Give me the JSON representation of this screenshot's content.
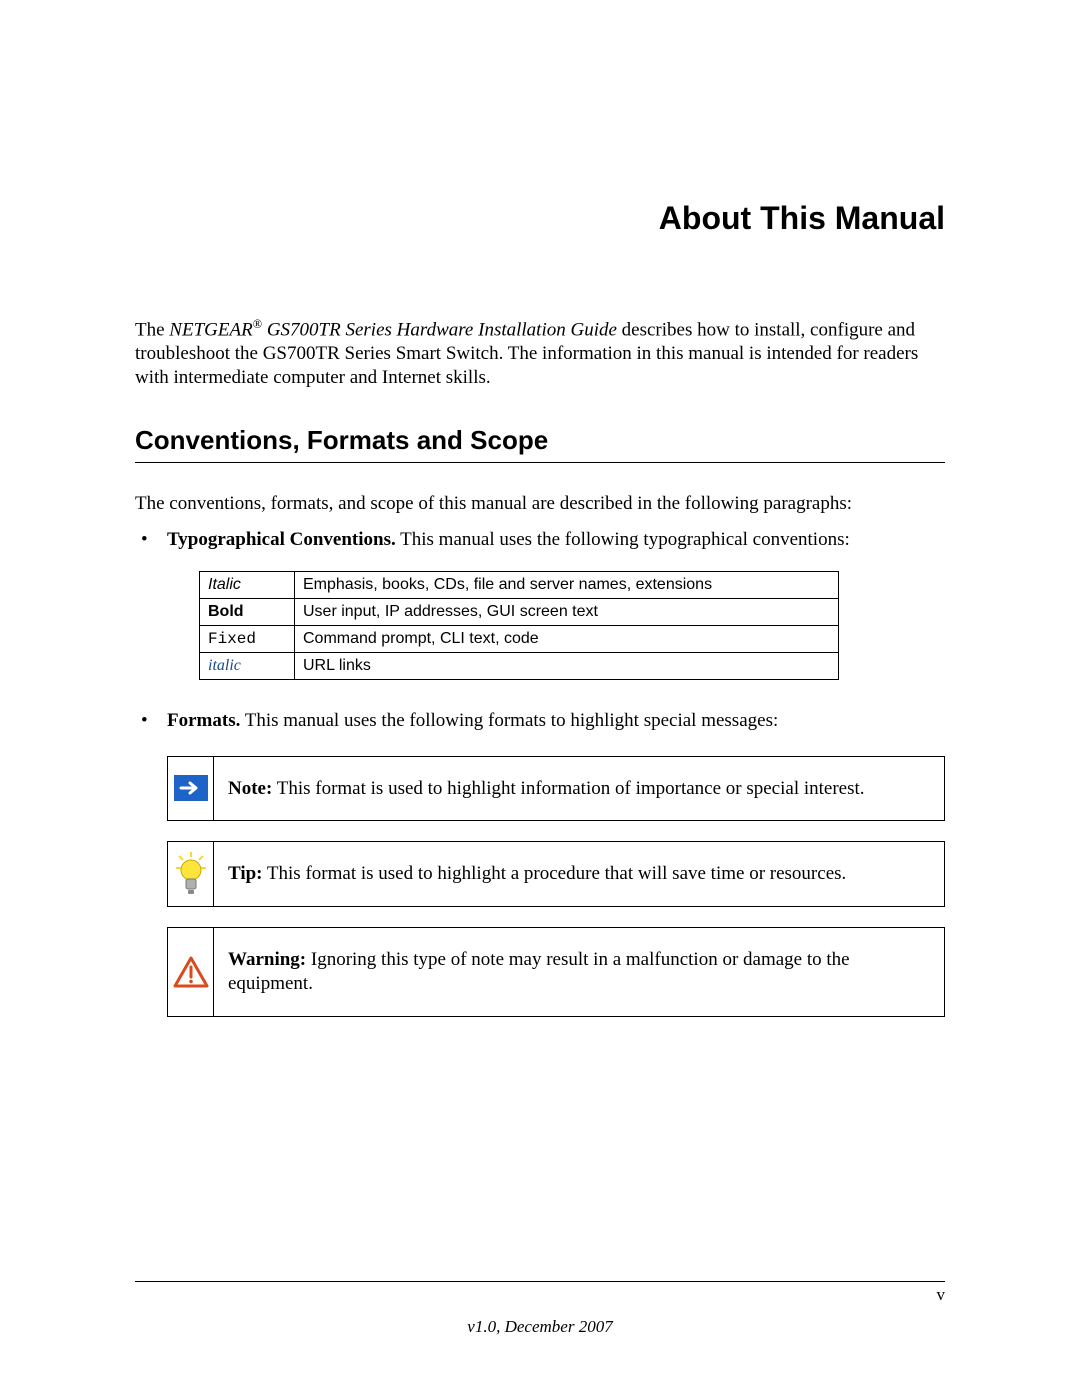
{
  "title": "About This Manual",
  "intro_prefix": "The ",
  "intro_brand": "NETGEAR",
  "intro_reg": "®",
  "intro_doc": " GS700TR Series Hardware Installation Guide",
  "intro_rest": " describes how to install, configure and troubleshoot the GS700TR Series Smart Switch. The information in this manual is intended for readers with intermediate computer and Internet skills.",
  "section_heading": "Conventions, Formats and Scope",
  "section_lead": "The conventions, formats, and scope of this manual are described in the following paragraphs:",
  "bullet1_label": "Typographical Conventions.",
  "bullet1_rest": " This manual uses the following typographical conventions:",
  "table": {
    "r1l": "Italic",
    "r1d": "Emphasis, books, CDs, file and server names, extensions",
    "r2l": "Bold",
    "r2d": "User input, IP addresses, GUI screen text",
    "r3l": "Fixed",
    "r3d": "Command prompt, CLI text, code",
    "r4l": "italic",
    "r4d": "URL links"
  },
  "bullet2_label": "Formats.",
  "bullet2_rest": " This manual uses the following formats to highlight special messages:",
  "note_label": "Note:",
  "note_text": " This format is used to highlight information of importance or special interest.",
  "tip_label": "Tip:",
  "tip_text": " This format is used to highlight a procedure that will save time or resources.",
  "warn_label": "Warning:",
  "warn_text": " Ignoring this type of note may result in a malfunction or damage to the equipment.",
  "page_number": "v",
  "version_line": "v1.0, December 2007"
}
